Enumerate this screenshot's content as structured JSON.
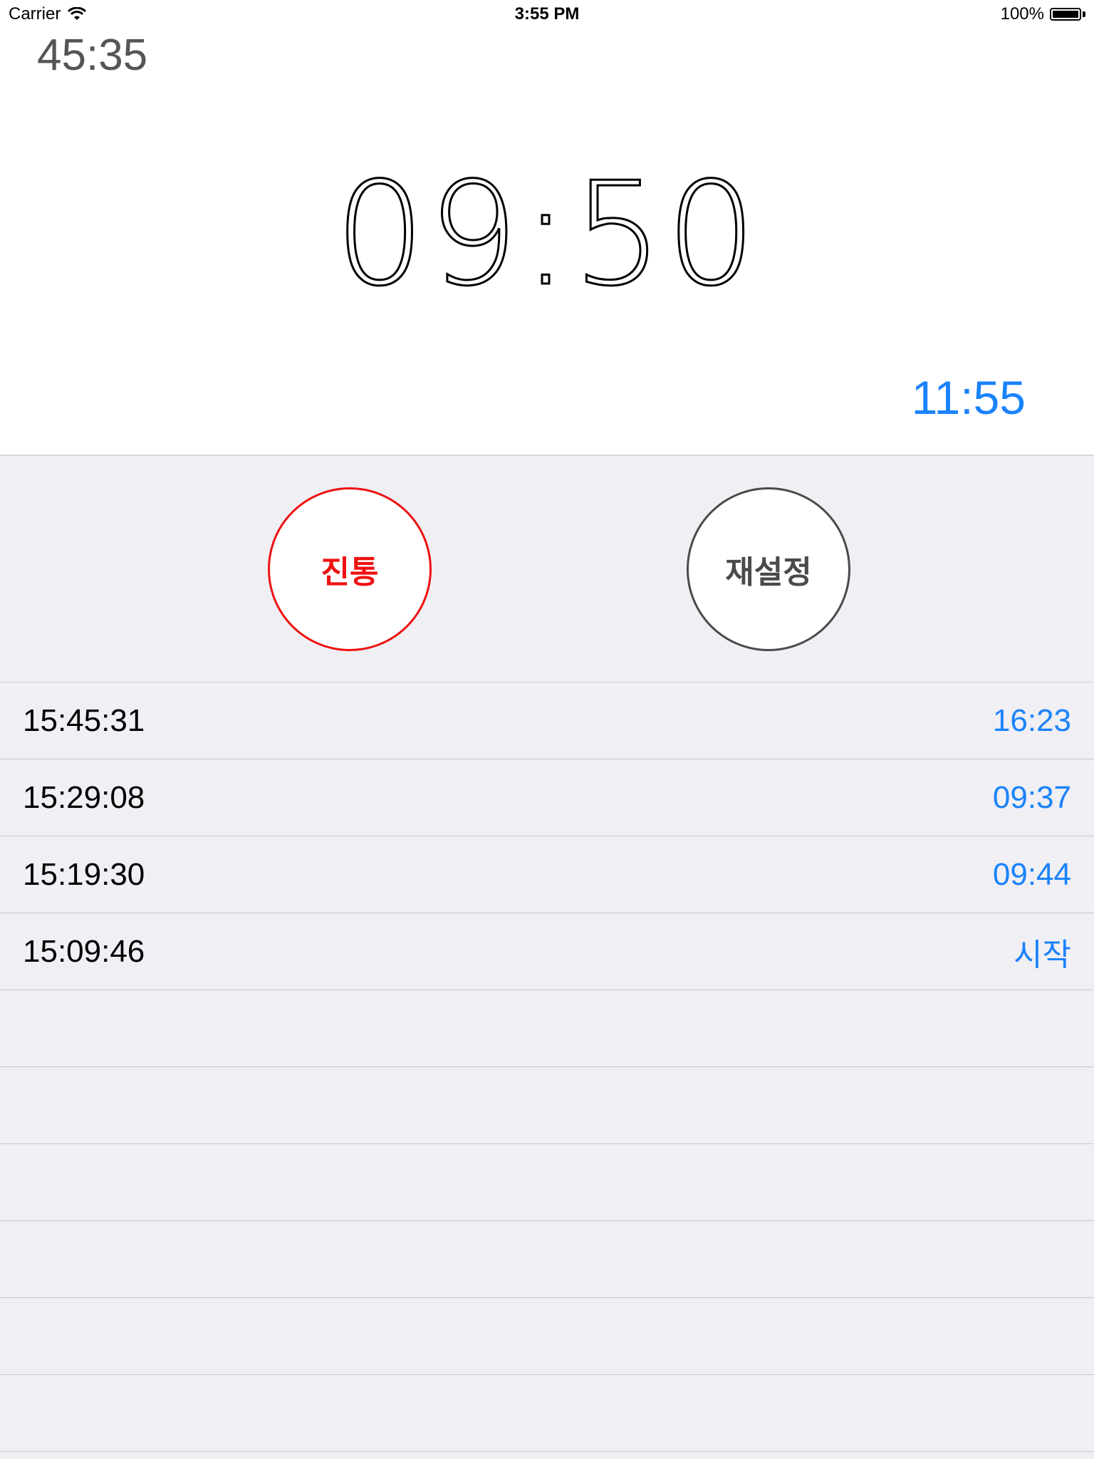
{
  "status_bar": {
    "carrier": "Carrier",
    "time": "3:55 PM",
    "battery": "100%"
  },
  "stopwatch": {
    "total_elapsed": "45:35",
    "main_time": "09:50",
    "current_lap": "11:55"
  },
  "buttons": {
    "stop_label": "진통",
    "reset_label": "재설정",
    "stop_color": "#ee1111",
    "reset_color": "#4a4a4a"
  },
  "laps": [
    {
      "timestamp": "15:45:31",
      "duration": "16:23"
    },
    {
      "timestamp": "15:29:08",
      "duration": "09:37"
    },
    {
      "timestamp": "15:19:30",
      "duration": "09:44"
    },
    {
      "timestamp": "15:09:46",
      "duration": "시작"
    },
    {
      "timestamp": "",
      "duration": ""
    },
    {
      "timestamp": "",
      "duration": ""
    },
    {
      "timestamp": "",
      "duration": ""
    },
    {
      "timestamp": "",
      "duration": ""
    },
    {
      "timestamp": "",
      "duration": ""
    },
    {
      "timestamp": "",
      "duration": ""
    }
  ],
  "colors": {
    "accent": "#1a82fb",
    "background": "#efeff4"
  },
  "icons": {
    "wifi": "wifi-icon",
    "battery": "battery-icon"
  }
}
